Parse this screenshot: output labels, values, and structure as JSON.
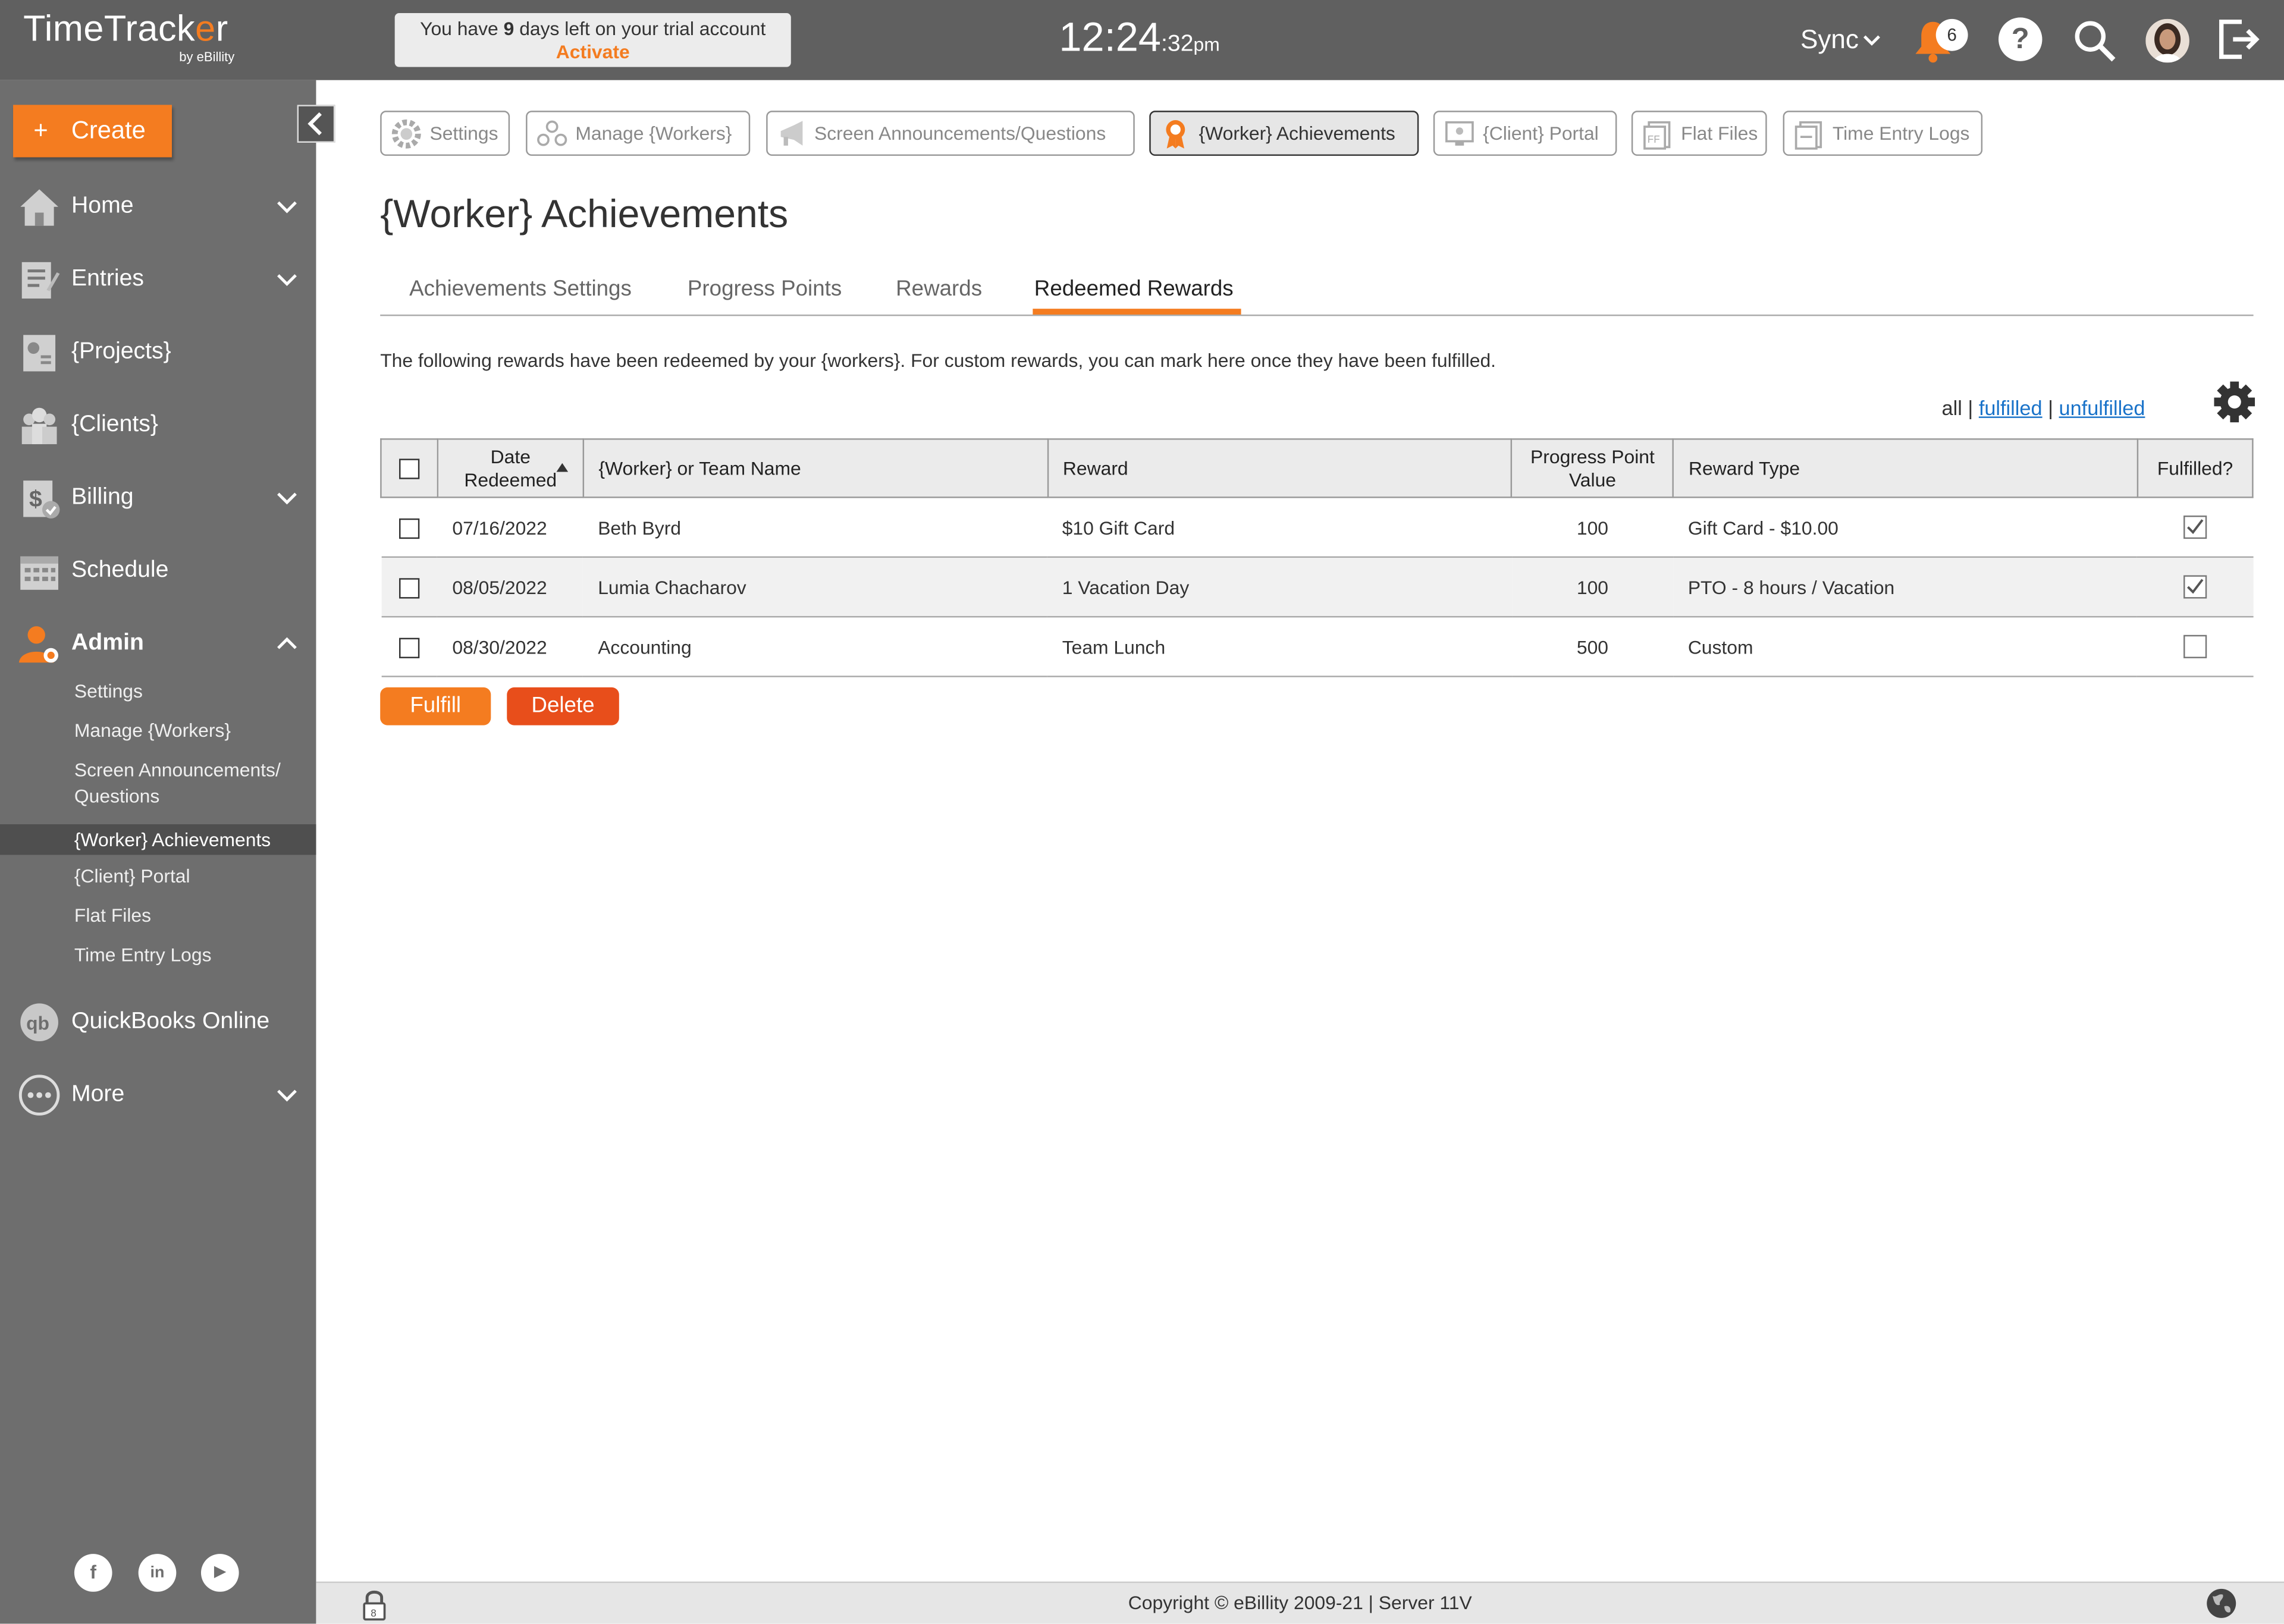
{
  "app": {
    "logo_main": "TimeTrack",
    "logo_o": "e",
    "logo_end": "r",
    "logo_sub": "by eBillity"
  },
  "trial": {
    "prefix": "You have ",
    "days": "9",
    "suffix": " days left on your trial account",
    "activate": "Activate"
  },
  "clock": {
    "hm": "12:24",
    "sec": ":32",
    "ampm": "pm"
  },
  "header": {
    "sync": "Sync",
    "notifications": "6",
    "help": "?"
  },
  "sidebar": {
    "create": "Create",
    "items": [
      {
        "label": "Home",
        "icon": "home-icon"
      },
      {
        "label": "Entries",
        "icon": "entries-icon"
      },
      {
        "label": "{Projects}",
        "icon": "projects-icon"
      },
      {
        "label": "{Clients}",
        "icon": "clients-icon"
      },
      {
        "label": "Billing",
        "icon": "billing-icon"
      },
      {
        "label": "Schedule",
        "icon": "calendar-icon"
      },
      {
        "label": "Admin",
        "icon": "admin-icon"
      },
      {
        "label": "QuickBooks Online",
        "icon": "quickbooks-icon"
      },
      {
        "label": "More",
        "icon": "more-icon"
      }
    ],
    "admin_sub": [
      "Settings",
      "Manage {Workers}",
      "Screen Announcements/",
      "Questions",
      "{Worker} Achievements",
      "{Client} Portal",
      "Flat Files",
      "Time Entry Logs"
    ]
  },
  "top_tabs": [
    "Settings",
    "Manage {Workers}",
    "Screen Announcements/Questions",
    "{Worker} Achievements",
    "{Client} Portal",
    "Flat Files",
    "Time Entry Logs"
  ],
  "page": {
    "title": "{Worker} Achievements",
    "subtabs": [
      "Achievements Settings",
      "Progress Points",
      "Rewards",
      "Redeemed Rewards"
    ],
    "active_subtab": "Redeemed Rewards",
    "description": "The following rewards have been redeemed by your {workers}. For custom rewards, you can mark here once they have been fulfilled.",
    "filters": {
      "all": "all",
      "sep": "|",
      "fulfilled": "fulfilled",
      "unfulfilled": "unfulfilled"
    }
  },
  "table": {
    "headers": {
      "date_1": "Date",
      "date_2": "Redeemed",
      "name": "{Worker} or Team Name",
      "reward": "Reward",
      "points_1": "Progress Point",
      "points_2": "Value",
      "type": "Reward Type",
      "fulfilled": "Fulfilled?"
    },
    "rows": [
      {
        "date": "07/16/2022",
        "name": "Beth Byrd",
        "reward": "$10 Gift Card",
        "points": "100",
        "type": "Gift Card - $10.00",
        "fulfilled": true
      },
      {
        "date": "08/05/2022",
        "name": "Lumia Chacharov",
        "reward": "1 Vacation Day",
        "points": "100",
        "type": "PTO - 8 hours / Vacation",
        "fulfilled": true
      },
      {
        "date": "08/30/2022",
        "name": "Accounting",
        "reward": "Team Lunch",
        "points": "500",
        "type": "Custom",
        "fulfilled": false
      }
    ]
  },
  "actions": {
    "fulfill": "Fulfill",
    "delete": "Delete"
  },
  "footer": {
    "copyright": "Copyright © eBillity 2009-21 | Server 11V"
  },
  "social": [
    "f",
    "in",
    "▶"
  ],
  "colors": {
    "accent": "#f47c20",
    "danger": "#e84e1b",
    "sidebar": "#6e6e6e",
    "topbar": "#606060",
    "link": "#1a73c9"
  }
}
